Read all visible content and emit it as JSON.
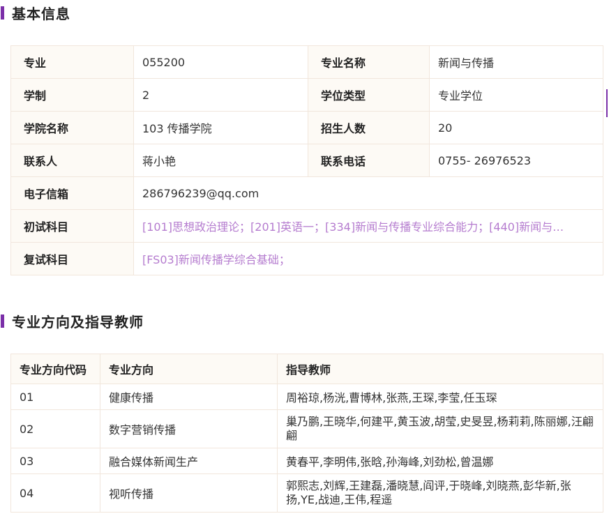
{
  "basic": {
    "title": "基本信息",
    "rows": [
      {
        "l1": "专业",
        "v1": "055200",
        "l2": "专业名称",
        "v2": "新闻与传播"
      },
      {
        "l1": "学制",
        "v1": "2",
        "l2": "学位类型",
        "v2": "专业学位"
      },
      {
        "l1": "学院名称",
        "v1": "103 传播学院",
        "l2": "招生人数",
        "v2": "20"
      },
      {
        "l1": "联系人",
        "v1": "蒋小艳",
        "l2": "联系电话",
        "v2": "0755- 26976523"
      }
    ],
    "email_label": "电子信箱",
    "email_value": "286796239@qq.com",
    "initial_label": "初试科目",
    "initial_value": "[101]思想政治理论；[201]英语一；[334]新闻与传播专业综合能力；[440]新闻与…",
    "retest_label": "复试科目",
    "retest_value": "[FS03]新闻传播学综合基础；"
  },
  "directions": {
    "title": "专业方向及指导教师",
    "headers": [
      "专业方向代码",
      "专业方向",
      "指导教师"
    ],
    "rows": [
      {
        "code": "01",
        "name": "健康传播",
        "teachers": "周裕琼,杨洸,曹博林,张燕,王琛,李莹,任玉琛"
      },
      {
        "code": "02",
        "name": "数字营销传播",
        "teachers": "巢乃鹏,王晓华,何建平,黄玉波,胡莹,史旻昱,杨莉莉,陈丽娜,汪翩翩"
      },
      {
        "code": "03",
        "name": "融合媒体新闻生产",
        "teachers": "黄春平,李明伟,张晗,孙海峰,刘劲松,曾温娜"
      },
      {
        "code": "04",
        "name": "视听传播",
        "teachers": "郭熙志,刘辉,王建磊,潘晓慧,阎评,于晓峰,刘晓燕,彭华新,张扬,YE,战迪,王伟,程遥"
      }
    ]
  },
  "colors": {
    "accent": "#7b2fa8",
    "link": "#b57ccf",
    "label_bg": "#fdfaf5",
    "border": "#f1e6dc"
  }
}
